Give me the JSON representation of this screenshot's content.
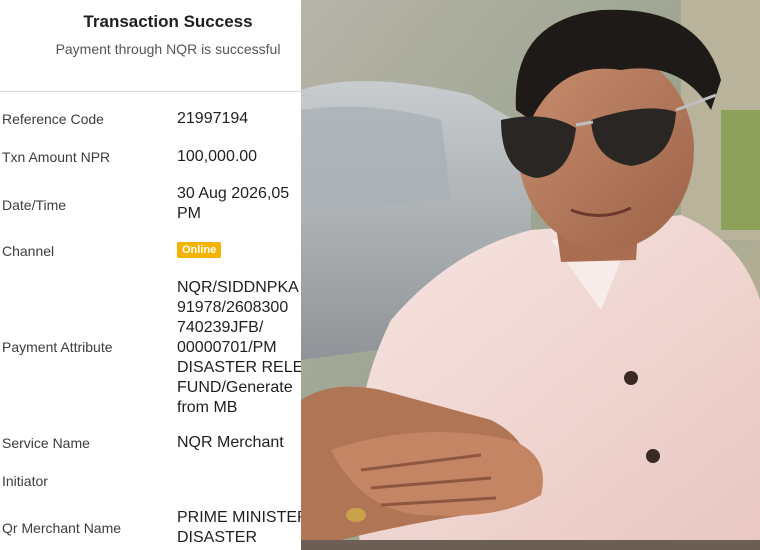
{
  "receipt": {
    "title": "Transaction Success",
    "subtitle": "Payment through NQR is successful",
    "rows": [
      {
        "label": "Reference Code",
        "value": "21997194"
      },
      {
        "label": "Txn Amount NPR",
        "value": "100,000.00"
      },
      {
        "label": "Date/Time",
        "value": "30 Aug 2026,05\nPM"
      },
      {
        "label": "Channel",
        "badge": "Online"
      },
      {
        "label": "Payment Attribute",
        "value": "NQR/SIDDNPKA\n91978/2608300\n740239JFB/\n00000701/PM\nDISASTER RELE\nFUND/Generate\nfrom MB"
      },
      {
        "label": "Service Name",
        "value": "NQR Merchant"
      },
      {
        "label": "Initiator",
        "value": ""
      },
      {
        "label": "Qr Merchant Name",
        "value": "PRIME MINISTER\nDISASTER"
      }
    ],
    "colors": {
      "badge": "#f5b301",
      "divider": "#d9d9d9"
    }
  },
  "photo": {
    "icon": "person-photo",
    "colors": {
      "shirt": "#f2d6d2",
      "skin": "#b5795c",
      "hair": "#1e1a17",
      "background": "#9aa48f"
    }
  }
}
